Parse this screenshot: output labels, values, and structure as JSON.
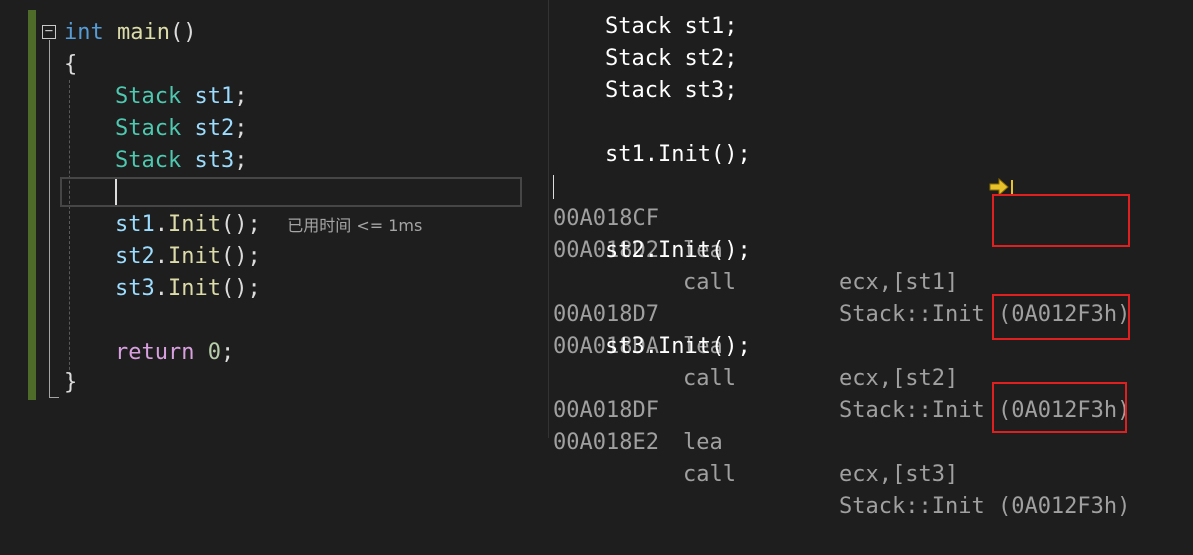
{
  "left_pane": {
    "fold_symbol": "−",
    "lines": {
      "l1": {
        "kw": "int",
        "fn": "main",
        "rest": "()"
      },
      "l2": {
        "text": "{"
      },
      "l3": {
        "type": "Stack",
        "var": "st1",
        "end": ";"
      },
      "l4": {
        "type": "Stack",
        "var": "st2",
        "end": ";"
      },
      "l5": {
        "type": "Stack",
        "var": "st3",
        "end": ";"
      },
      "l7": {
        "obj": "st1",
        "dot": ".",
        "fn": "Init",
        "rest": "();",
        "hint": "已用时间 <= 1ms"
      },
      "l8": {
        "obj": "st2",
        "dot": ".",
        "fn": "Init",
        "rest": "();"
      },
      "l9": {
        "obj": "st3",
        "dot": ".",
        "fn": "Init",
        "rest": "();"
      },
      "l11": {
        "kw": "return",
        "num": "0",
        "end": ";"
      },
      "l12": {
        "text": "}"
      }
    }
  },
  "right_pane": {
    "src_lines": [
      "Stack st1;",
      "Stack st2;",
      "Stack st3;",
      "st1.Init();",
      "st2.Init();",
      "st3.Init();"
    ],
    "asm": [
      {
        "addr": "00A018CF",
        "op": "lea",
        "arg": "ecx,[st1]"
      },
      {
        "addr": "00A018D2",
        "op": "call",
        "arg": "Stack::Init",
        "target": "(0A012F3h)"
      },
      {
        "addr": "00A018D7",
        "op": "lea",
        "arg": "ecx,[st2]"
      },
      {
        "addr": "00A018DA",
        "op": "call",
        "arg": "Stack::Init",
        "target": "(0A012F3h)"
      },
      {
        "addr": "00A018DF",
        "op": "lea",
        "arg": "ecx,[st3]"
      },
      {
        "addr": "00A018E2",
        "op": "call",
        "arg": "Stack::Init",
        "target": "(0A012F3h)"
      }
    ],
    "highlight_color": "#e02020"
  },
  "icons": {
    "fold": "collapse-box-icon",
    "next_statement": "arrow-right-icon"
  }
}
